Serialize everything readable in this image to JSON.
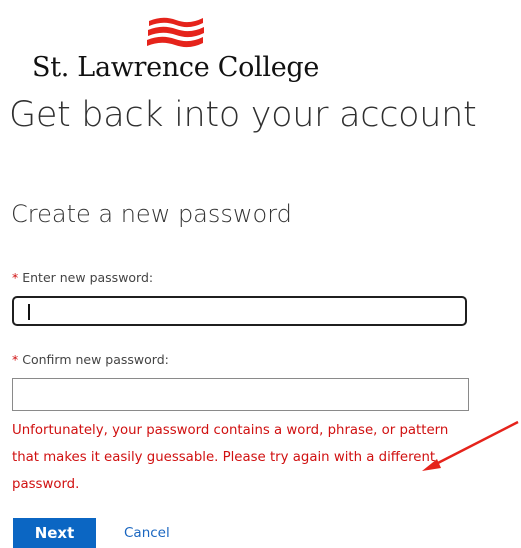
{
  "branding": {
    "college_name": "St. Lawrence College",
    "logo_icon": "red-waves-logo",
    "logo_color": "#e5231b"
  },
  "page": {
    "title": "Get back into your account",
    "section_title": "Create a new password"
  },
  "form": {
    "required_marker": "*",
    "new_password_label": "Enter new password:",
    "new_password_value": "",
    "confirm_password_label": "Confirm new password:",
    "confirm_password_value": "",
    "error_message": "Unfortunately, your password contains a word, phrase, or pattern that makes it easily guessable. Please try again with a different password.",
    "error_color": "#d01010"
  },
  "actions": {
    "next_label": "Next",
    "cancel_label": "Cancel",
    "accent_color": "#0b66c3"
  },
  "annotation": {
    "arrow_icon": "red-arrow-icon"
  }
}
